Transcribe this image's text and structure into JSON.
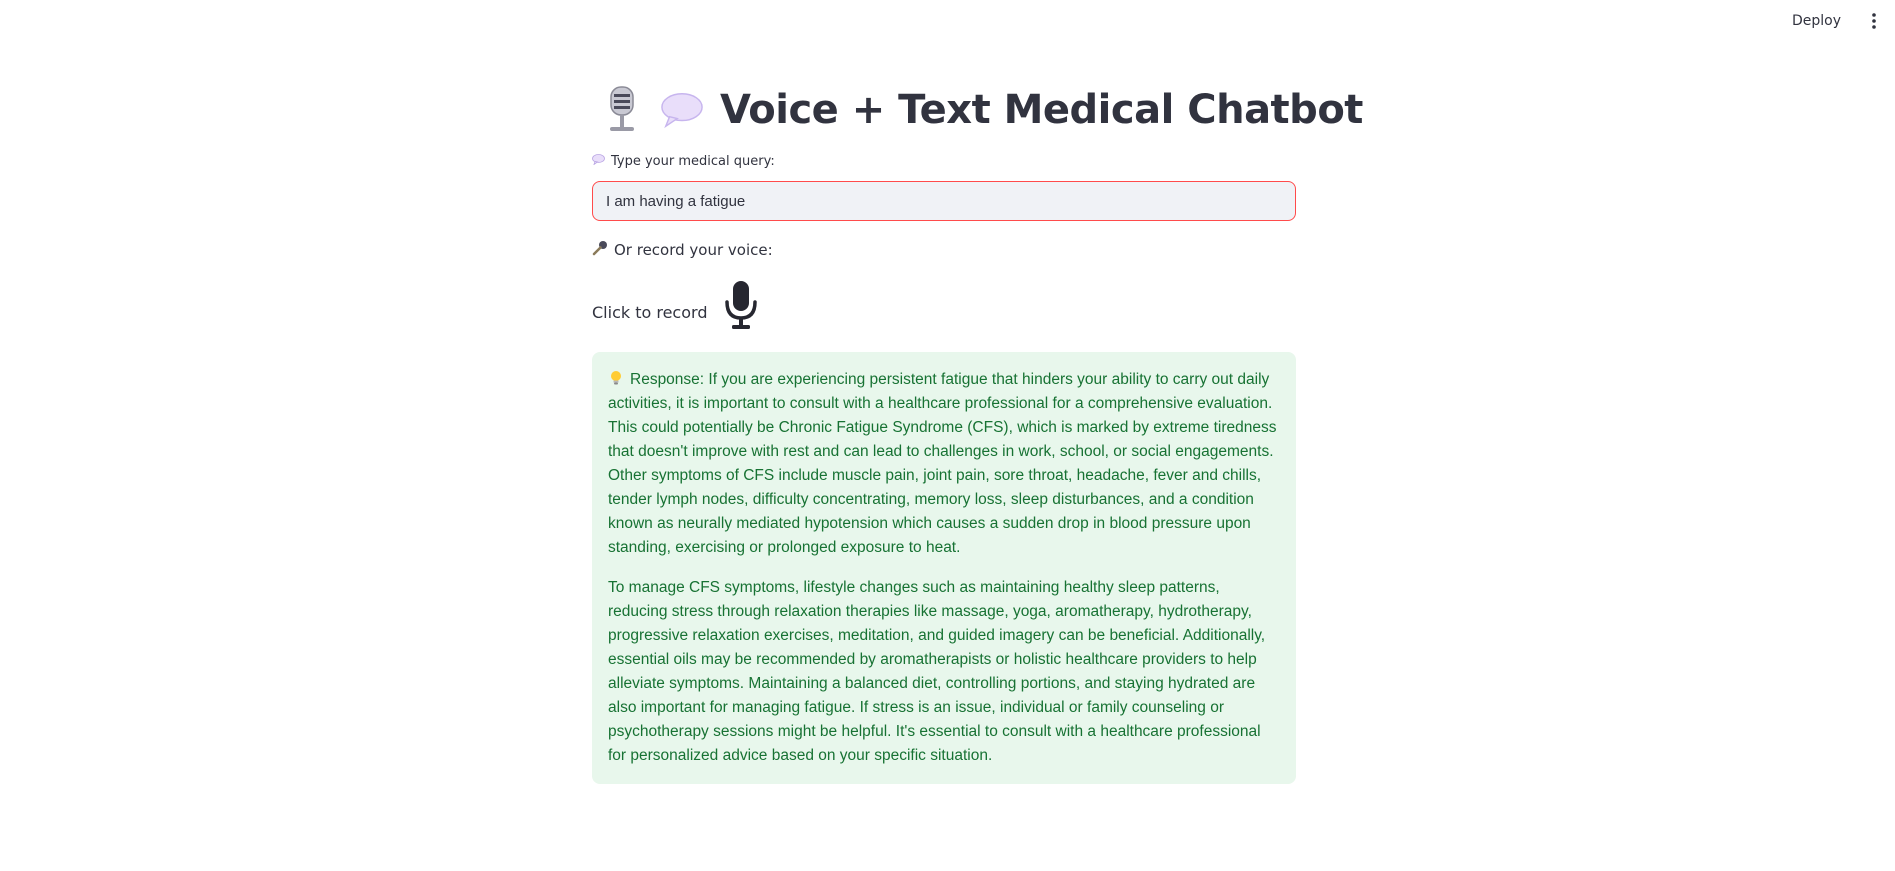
{
  "header": {
    "deploy_label": "Deploy",
    "menu_icon": "vertical-ellipsis-icon"
  },
  "title": {
    "icon_1": "studio-microphone-icon",
    "icon_2": "speech-balloon-icon",
    "text": "Voice + Text Medical Chatbot"
  },
  "query": {
    "label": "Type your medical query:",
    "label_icon": "speech-balloon-icon",
    "value": "I am having a fatigue",
    "focused": true
  },
  "voice": {
    "label": "Or record your voice:",
    "label_icon": "microphone-icon",
    "record_text": "Click to record",
    "record_icon": "microphone-icon"
  },
  "response": {
    "icon": "light-bulb-icon",
    "paragraph_1": "Response: If you are experiencing persistent fatigue that hinders your ability to carry out daily activities, it is important to consult with a healthcare professional for a comprehensive evaluation. This could potentially be Chronic Fatigue Syndrome (CFS), which is marked by extreme tiredness that doesn't improve with rest and can lead to challenges in work, school, or social engagements. Other symptoms of CFS include muscle pain, joint pain, sore throat, headache, fever and chills, tender lymph nodes, difficulty concentrating, memory loss, sleep disturbances, and a condition known as neurally mediated hypotension which causes a sudden drop in blood pressure upon standing, exercising or prolonged exposure to heat.",
    "paragraph_2": "To manage CFS symptoms, lifestyle changes such as maintaining healthy sleep patterns, reducing stress through relaxation therapies like massage, yoga, aromatherapy, hydrotherapy, progressive relaxation exercises, meditation, and guided imagery can be beneficial. Additionally, essential oils may be recommended by aromatherapists or holistic healthcare providers to help alleviate symptoms. Maintaining a balanced diet, controlling portions, and staying hydrated are also important for managing fatigue. If stress is an issue, individual or family counseling or psychotherapy sessions might be helpful. It's essential to consult with a healthcare professional for personalized advice based on your specific situation."
  },
  "colors": {
    "accent": "#ff4b4b",
    "text": "#31333f",
    "input_bg": "#f0f2f6",
    "success_bg": "#e8f7ec",
    "success_text": "#177233"
  }
}
